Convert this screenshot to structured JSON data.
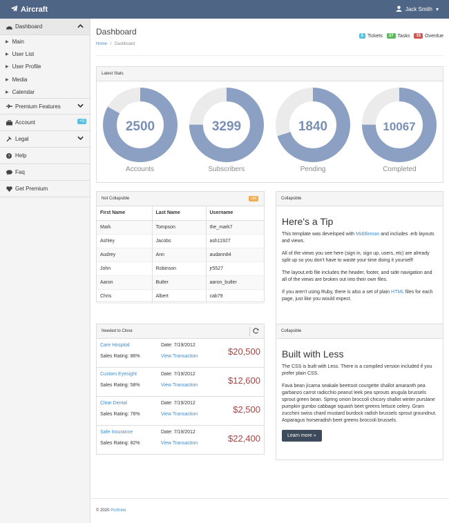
{
  "brand": {
    "name": "Aircraft"
  },
  "user": {
    "name": "Jack Smith"
  },
  "sidebar": {
    "dashboard_label": "Dashboard",
    "sub_items": [
      "Main",
      "User List",
      "User Profile",
      "Media",
      "Calendar"
    ],
    "premium_label": "Premium Features",
    "account_label": "Account",
    "account_badge": "+3",
    "legal_label": "Legal",
    "help_label": "Help",
    "faq_label": "Faq",
    "get_premium_label": "Get Premium"
  },
  "page": {
    "title": "Dashboard",
    "breadcrumb_home": "Home",
    "breadcrumb_sep": "/",
    "breadcrumb_current": "Dashboard"
  },
  "header_stats": {
    "tickets_count": "5",
    "tickets_label": "Tickets",
    "tasks_count": "27",
    "tasks_label": "Tasks",
    "overdue_count": "15",
    "overdue_label": "Overdue"
  },
  "colors": {
    "tickets": "#5bc0de",
    "tasks": "#5cb85c",
    "overdue": "#d9534f",
    "donut": "#8ca0c4",
    "donut_track": "#ebebeb"
  },
  "latest_stats": {
    "title": "Latest Stats",
    "items": [
      {
        "value": "2500",
        "label": "Accounts",
        "fraction": 0.83
      },
      {
        "value": "3299",
        "label": "Subscribers",
        "fraction": 0.75
      },
      {
        "value": "1840",
        "label": "Pending",
        "fraction": 0.7
      },
      {
        "value": "10067",
        "label": "Completed",
        "fraction": 0.75
      }
    ]
  },
  "users_table": {
    "title": "Not Collapsible",
    "badge": "+99",
    "headers": [
      "First Name",
      "Last Name",
      "Username"
    ],
    "rows": [
      [
        "Mark",
        "Tompson",
        "the_mark7"
      ],
      [
        "Ashley",
        "Jacobs",
        "ash11927"
      ],
      [
        "Audrey",
        "Ann",
        "audann84"
      ],
      [
        "John",
        "Robinson",
        "jr5527"
      ],
      [
        "Aaron",
        "Butler",
        "aaron_butler"
      ],
      [
        "Chris",
        "Albert",
        "cab79"
      ]
    ]
  },
  "tip": {
    "panel_title": "Collapsible",
    "heading": "Here's a Tip",
    "p1_a": "This template was developed with ",
    "p1_link": "Middleman",
    "p1_b": " and includes .erb layouts and views.",
    "p2": "All of the views you see here (sign in, sign up, users, etc) are already split up so you don't have to waste your time doing it yourself!",
    "p3": "The layout.erb file includes the header, footer, and side navigation and all of the views are broken out into their own files.",
    "p4_a": "If you aren't using Ruby, there is also a set of plain ",
    "p4_link": "HTML",
    "p4_b": " files for each page, just like you would expect."
  },
  "needed_to_close": {
    "title": "Needed to Close",
    "date_prefix": "Date: ",
    "rating_prefix": "Sales Rating: ",
    "view_label": "View Transaction",
    "rows": [
      {
        "name": "Care Hospital",
        "date": "7/19/2012",
        "rating": "86%",
        "amount": "$20,500"
      },
      {
        "name": "Custom Eyesight",
        "date": "7/19/2012",
        "rating": "58%",
        "amount": "$12,600"
      },
      {
        "name": "Clear Dental",
        "date": "7/19/2012",
        "rating": "76%",
        "amount": "$2,500"
      },
      {
        "name": "Safe Insurance",
        "date": "7/19/2012",
        "rating": "82%",
        "amount": "$22,400"
      }
    ]
  },
  "less": {
    "panel_title": "Collapsible",
    "heading": "Built with Less",
    "p1": "The CSS is built with Less. There is a compiled version included if you prefer plain CSS.",
    "p2": "Fava bean jícama seakale beetroot courgette shallot amaranth pea garbanzo carrot radicchio peanut leek pea sprouts arugula brussels sprout green bean. Spring onion broccoli chicory shallot winter purslane pumpkin gumbo cabbage squash beet greens lettuce celery. Gram zucchini swiss chard mustard burdock radish brussels sprout groundnut. Asparagus horseradish beet greens broccoli brussels.",
    "button": "Learn more »"
  },
  "footer": {
    "copyright": "© 2020 ",
    "link": "Portnine"
  }
}
